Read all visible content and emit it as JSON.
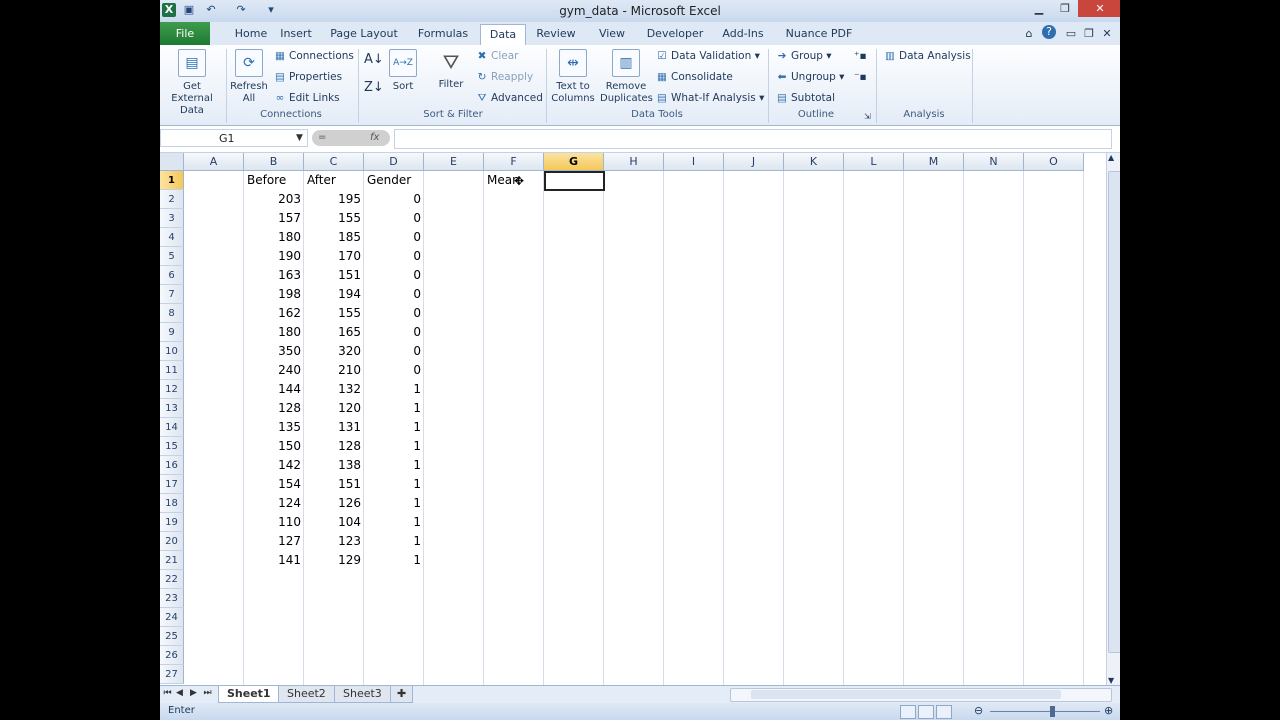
{
  "app": {
    "title": "gym_data  -  Microsoft Excel"
  },
  "tabs": [
    "File",
    "Home",
    "Insert",
    "Page Layout",
    "Formulas",
    "Data",
    "Review",
    "View",
    "Developer",
    "Add-Ins",
    "Nuance PDF"
  ],
  "ribbon": {
    "get_external": "Get External Data",
    "refresh_all": "Refresh All",
    "connections": "Connections",
    "properties": "Properties",
    "edit_links": "Edit Links",
    "sort_az": "A→Z",
    "sort": "Sort",
    "filter": "Filter",
    "clear": "Clear",
    "reapply": "Reapply",
    "advanced": "Advanced",
    "text_to_columns": "Text to Columns",
    "remove_duplicates": "Remove Duplicates",
    "data_validation": "Data Validation",
    "consolidate": "Consolidate",
    "what_if": "What-If Analysis",
    "group": "Group",
    "ungroup": "Ungroup",
    "subtotal": "Subtotal",
    "data_analysis": "Data Analysis",
    "groups": {
      "connections": "Connections",
      "sort_filter": "Sort & Filter",
      "data_tools": "Data Tools",
      "outline": "Outline",
      "analysis": "Analysis"
    }
  },
  "formula_bar": {
    "name_box": "G1",
    "content": ""
  },
  "columns": [
    "A",
    "B",
    "C",
    "D",
    "E",
    "F",
    "G",
    "H",
    "I",
    "J",
    "K",
    "L",
    "M",
    "N",
    "O"
  ],
  "rows": [
    "1",
    "2",
    "3",
    "4",
    "5",
    "6",
    "7",
    "8",
    "9",
    "10",
    "11",
    "12",
    "13",
    "14",
    "15",
    "16",
    "17",
    "18",
    "19",
    "20",
    "21",
    "22",
    "23",
    "24",
    "25",
    "26",
    "27"
  ],
  "headers": {
    "before": "Before",
    "after": "After",
    "gender": "Gender",
    "mean": "Mean"
  },
  "data_rows": [
    {
      "before": "203",
      "after": "195",
      "gender": "0"
    },
    {
      "before": "157",
      "after": "155",
      "gender": "0"
    },
    {
      "before": "180",
      "after": "185",
      "gender": "0"
    },
    {
      "before": "190",
      "after": "170",
      "gender": "0"
    },
    {
      "before": "163",
      "after": "151",
      "gender": "0"
    },
    {
      "before": "198",
      "after": "194",
      "gender": "0"
    },
    {
      "before": "162",
      "after": "155",
      "gender": "0"
    },
    {
      "before": "180",
      "after": "165",
      "gender": "0"
    },
    {
      "before": "350",
      "after": "320",
      "gender": "0"
    },
    {
      "before": "240",
      "after": "210",
      "gender": "0"
    },
    {
      "before": "144",
      "after": "132",
      "gender": "1"
    },
    {
      "before": "128",
      "after": "120",
      "gender": "1"
    },
    {
      "before": "135",
      "after": "131",
      "gender": "1"
    },
    {
      "before": "150",
      "after": "128",
      "gender": "1"
    },
    {
      "before": "142",
      "after": "138",
      "gender": "1"
    },
    {
      "before": "154",
      "after": "151",
      "gender": "1"
    },
    {
      "before": "124",
      "after": "126",
      "gender": "1"
    },
    {
      "before": "110",
      "after": "104",
      "gender": "1"
    },
    {
      "before": "127",
      "after": "123",
      "gender": "1"
    },
    {
      "before": "141",
      "after": "129",
      "gender": "1"
    }
  ],
  "sheets": [
    "Sheet1",
    "Sheet2",
    "Sheet3"
  ],
  "status": {
    "text": "Enter"
  }
}
